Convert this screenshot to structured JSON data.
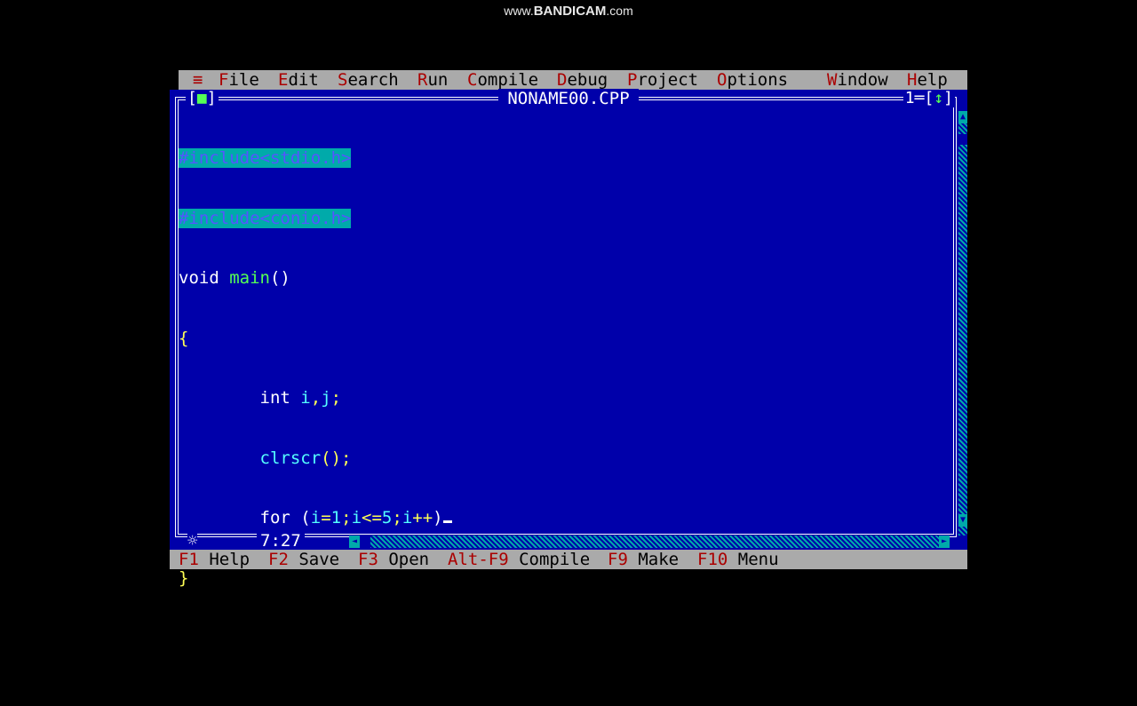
{
  "watermark": {
    "prefix": "www.",
    "brand": "BANDICAM",
    "suffix": ".com"
  },
  "menu": {
    "system": "≡",
    "items": [
      {
        "hot": "F",
        "rest": "ile"
      },
      {
        "hot": "E",
        "rest": "dit"
      },
      {
        "hot": "S",
        "rest": "earch"
      },
      {
        "hot": "R",
        "rest": "un"
      },
      {
        "hot": "C",
        "rest": "ompile"
      },
      {
        "hot": "D",
        "rest": "ebug"
      },
      {
        "hot": "P",
        "rest": "roject"
      },
      {
        "hot": "O",
        "rest": "ptions"
      },
      {
        "hot": "W",
        "rest": "indow"
      },
      {
        "hot": "H",
        "rest": "elp"
      }
    ]
  },
  "window": {
    "title": "NONAME00.CPP",
    "close_box": "■",
    "number": "1",
    "zoom": "↕"
  },
  "code": {
    "line1": "#include<stdio.h>",
    "line2": "#include<conio.h>",
    "line3_kw": "void",
    "line3_id": "main",
    "line3_sym": "()",
    "line4": "{",
    "line5_kw": "int",
    "line5_id1": "i",
    "line5_sym1": ",",
    "line5_id2": "j",
    "line5_sym2": ";",
    "line6_id": "clrscr",
    "line6_sym": "();",
    "line7_kw": "for",
    "line7_a": "(",
    "line7_b": "i",
    "line7_c": "=",
    "line7_d": "1",
    "line7_e": ";",
    "line7_f": "i",
    "line7_g": "<=",
    "line7_h": "5",
    "line7_i": ";",
    "line7_j": "i",
    "line7_k": "++",
    "line7_l": ")",
    "line8": "}"
  },
  "status": {
    "position": "7:27",
    "modified": "☼"
  },
  "footer": [
    {
      "key": "F1",
      "label": "Help"
    },
    {
      "key": "F2",
      "label": "Save"
    },
    {
      "key": "F3",
      "label": "Open"
    },
    {
      "key": "Alt-F9",
      "label": "Compile"
    },
    {
      "key": "F9",
      "label": "Make"
    },
    {
      "key": "F10",
      "label": "Menu"
    }
  ]
}
